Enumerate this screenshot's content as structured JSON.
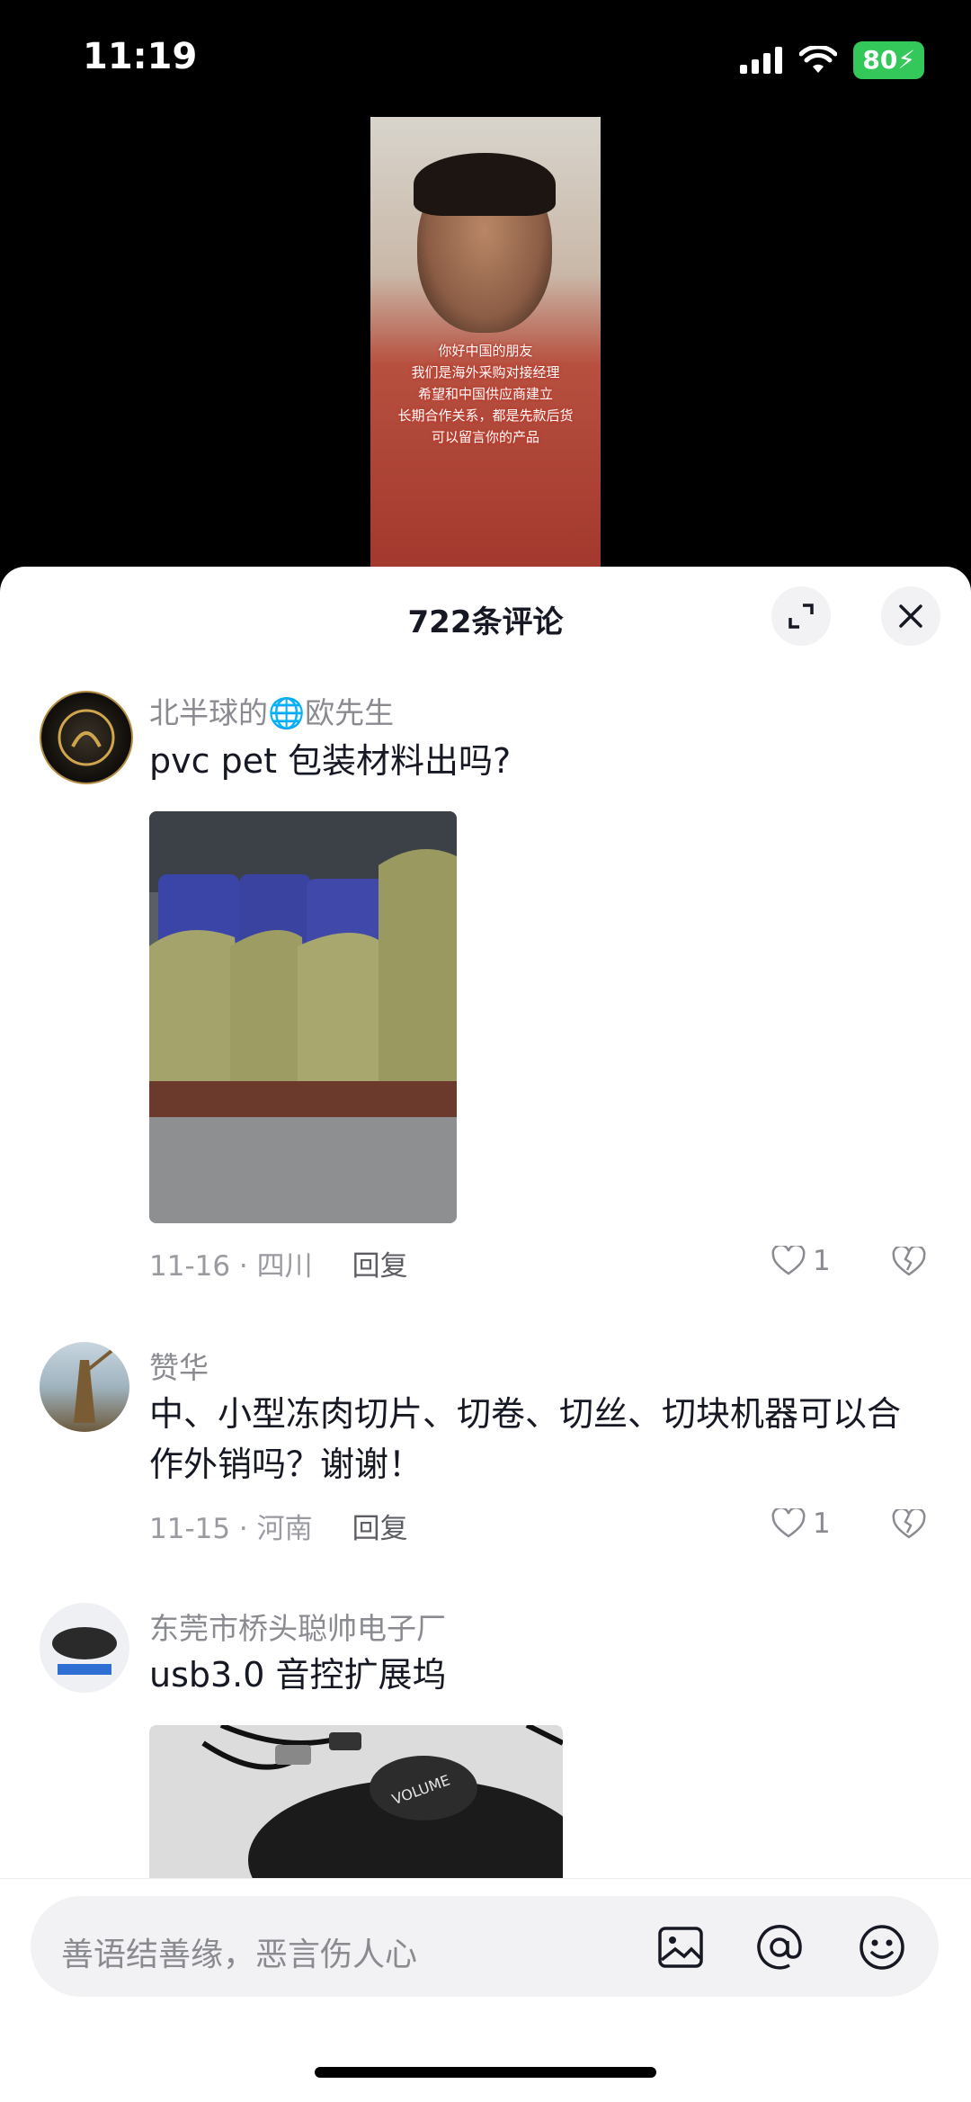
{
  "status_bar": {
    "time": "11:19",
    "battery": "80"
  },
  "video": {
    "caption_lines": [
      "你好中国的朋友",
      "我们是海外采购对接经理",
      "希望和中国供应商建立",
      "长期合作关系，都是先款后货",
      "可以留言你的产品"
    ]
  },
  "sheet": {
    "title": "722条评论"
  },
  "comments": [
    {
      "user": "北半球的🌐欧先生",
      "text": "pvc pet 包装材料出吗?",
      "date_loc": "11-16 · 四川",
      "reply": "回复",
      "likes": "1"
    },
    {
      "user": "赞华",
      "text": "中、小型冻肉切片、切卷、切丝、切块机器可以合作外销吗？谢谢！",
      "date_loc": "11-15 · 河南",
      "reply": "回复",
      "likes": "1"
    },
    {
      "user": "东莞市桥头聪帅电子厂",
      "text": "usb3.0 音控扩展坞",
      "image_text": "VOLUME"
    }
  ],
  "input": {
    "placeholder": "善语结善缘，恶言伤人心"
  }
}
